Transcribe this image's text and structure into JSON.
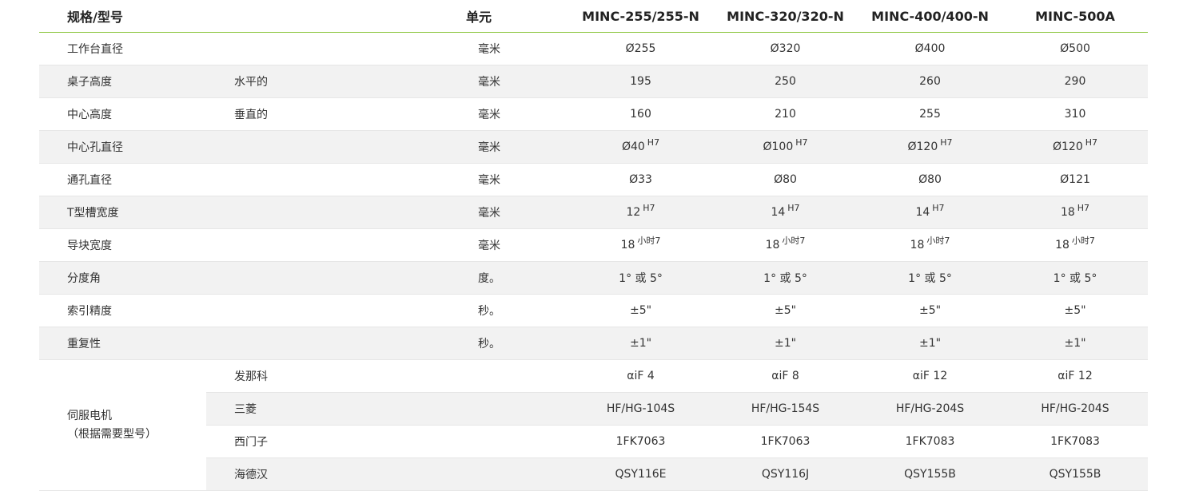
{
  "header": {
    "spec_label": "规格/型号",
    "unit_label": "单元",
    "models": [
      "MINC-255/255-N",
      "MINC-320/320-N",
      "MINC-400/400-N",
      "MINC-500A"
    ]
  },
  "rows": [
    {
      "label": "工作台直径",
      "sub": "",
      "unit": "毫米",
      "values": [
        {
          "v": "Ø255",
          "s": ""
        },
        {
          "v": "Ø320",
          "s": ""
        },
        {
          "v": "Ø400",
          "s": ""
        },
        {
          "v": "Ø500",
          "s": ""
        }
      ]
    },
    {
      "label": "桌子高度",
      "sub": "水平的",
      "unit": "毫米",
      "values": [
        {
          "v": "195",
          "s": ""
        },
        {
          "v": "250",
          "s": ""
        },
        {
          "v": "260",
          "s": ""
        },
        {
          "v": "290",
          "s": ""
        }
      ]
    },
    {
      "label": "中心高度",
      "sub": "垂直的",
      "unit": "毫米",
      "values": [
        {
          "v": "160",
          "s": ""
        },
        {
          "v": "210",
          "s": ""
        },
        {
          "v": "255",
          "s": ""
        },
        {
          "v": "310",
          "s": ""
        }
      ]
    },
    {
      "label": "中心孔直径",
      "sub": "",
      "unit": "毫米",
      "values": [
        {
          "v": "Ø40",
          "s": "H7"
        },
        {
          "v": "Ø100",
          "s": "H7"
        },
        {
          "v": "Ø120",
          "s": "H7"
        },
        {
          "v": "Ø120",
          "s": "H7"
        }
      ]
    },
    {
      "label": "通孔直径",
      "sub": "",
      "unit": "毫米",
      "values": [
        {
          "v": "Ø33",
          "s": ""
        },
        {
          "v": "Ø80",
          "s": ""
        },
        {
          "v": "Ø80",
          "s": ""
        },
        {
          "v": "Ø121",
          "s": ""
        }
      ]
    },
    {
      "label": "T型槽宽度",
      "sub": "",
      "unit": "毫米",
      "values": [
        {
          "v": "12",
          "s": "H7"
        },
        {
          "v": "14",
          "s": "H7"
        },
        {
          "v": "14",
          "s": "H7"
        },
        {
          "v": "18",
          "s": "H7"
        }
      ]
    },
    {
      "label": "导块宽度",
      "sub": "",
      "unit": "毫米",
      "values": [
        {
          "v": "18",
          "s": "小时7"
        },
        {
          "v": "18",
          "s": "小时7"
        },
        {
          "v": "18",
          "s": "小时7"
        },
        {
          "v": "18",
          "s": "小时7"
        }
      ]
    },
    {
      "label": "分度角",
      "sub": "",
      "unit": "度。",
      "values": [
        {
          "v": "1° 或 5°",
          "s": ""
        },
        {
          "v": "1° 或 5°",
          "s": ""
        },
        {
          "v": "1° 或 5°",
          "s": ""
        },
        {
          "v": "1° 或 5°",
          "s": ""
        }
      ]
    },
    {
      "label": "索引精度",
      "sub": "",
      "unit": "秒。",
      "values": [
        {
          "v": "±5\"",
          "s": ""
        },
        {
          "v": "±5\"",
          "s": ""
        },
        {
          "v": "±5\"",
          "s": ""
        },
        {
          "v": "±5\"",
          "s": ""
        }
      ]
    },
    {
      "label": "重复性",
      "sub": "",
      "unit": "秒。",
      "values": [
        {
          "v": "±1\"",
          "s": ""
        },
        {
          "v": "±1\"",
          "s": ""
        },
        {
          "v": "±1\"",
          "s": ""
        },
        {
          "v": "±1\"",
          "s": ""
        }
      ]
    }
  ],
  "servo": {
    "label_line1": "伺服电机",
    "label_line2": "（根据需要型号）",
    "brands": [
      {
        "name": "发那科",
        "values": [
          "αiF 4",
          "αiF 8",
          "αiF 12",
          "αiF 12"
        ]
      },
      {
        "name": "三菱",
        "values": [
          "HF/HG-104S",
          "HF/HG-154S",
          "HF/HG-204S",
          "HF/HG-204S"
        ]
      },
      {
        "name": "西门子",
        "values": [
          "1FK7063",
          "1FK7063",
          "1FK7083",
          "1FK7083"
        ]
      },
      {
        "name": "海德汉",
        "values": [
          "QSY116E",
          "QSY116J",
          "QSY155B",
          "QSY155B"
        ]
      }
    ]
  },
  "colors": {
    "header_rule": "#8cc63f",
    "stripe": "#f2f2f2",
    "row_border": "#e6e6e6",
    "text": "#333333"
  }
}
